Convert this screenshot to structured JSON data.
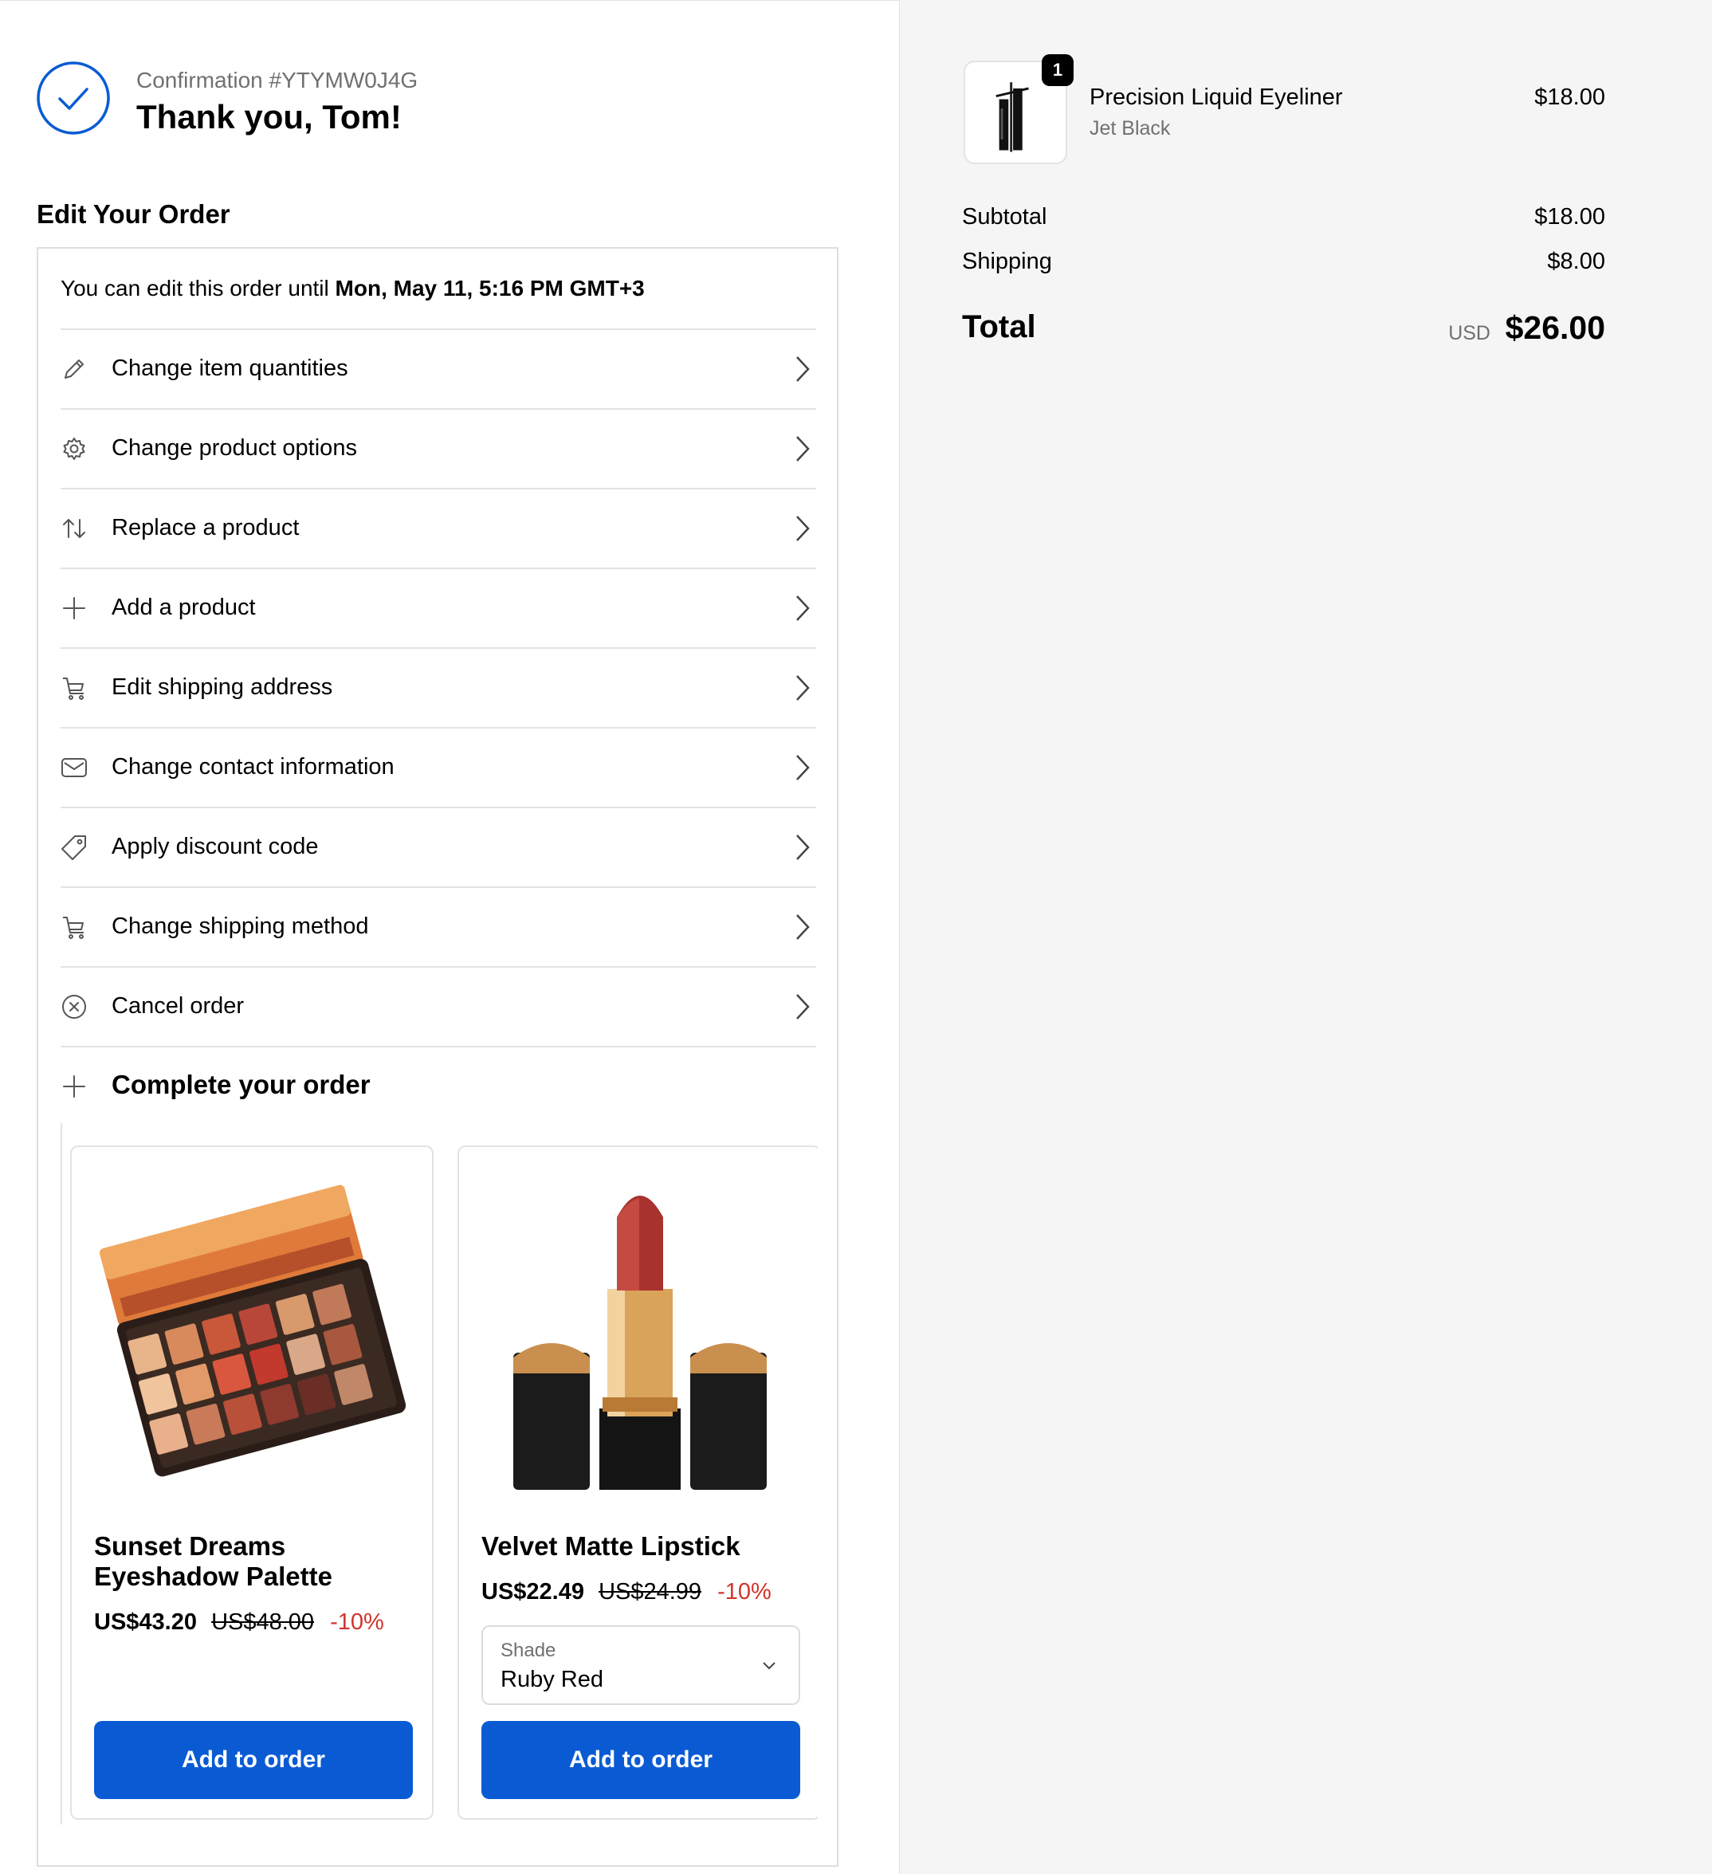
{
  "header": {
    "confirmation": "Confirmation #YTYMW0J4G",
    "thanks": "Thank you, Tom!"
  },
  "edit": {
    "title": "Edit Your Order",
    "note_prefix": "You can edit this order until ",
    "note_deadline": "Mon, May 11, 5:16 PM GMT+3",
    "options": [
      {
        "label": "Change item quantities",
        "icon": "pencil-icon"
      },
      {
        "label": "Change product options",
        "icon": "gear-icon"
      },
      {
        "label": "Replace a product",
        "icon": "swap-arrows-icon"
      },
      {
        "label": "Add a product",
        "icon": "plus-icon"
      },
      {
        "label": "Edit shipping address",
        "icon": "cart-icon"
      },
      {
        "label": "Change contact information",
        "icon": "envelope-icon"
      },
      {
        "label": "Apply discount code",
        "icon": "tag-icon"
      },
      {
        "label": "Change shipping method",
        "icon": "cart-icon"
      },
      {
        "label": "Cancel order",
        "icon": "close-circle-icon"
      }
    ],
    "complete_label": "Complete your order"
  },
  "upsell": [
    {
      "name": "Sunset Dreams Eyeshadow Palette",
      "price": "US$43.20",
      "compare_price": "US$48.00",
      "discount": "-10%",
      "button": "Add to order"
    },
    {
      "name": "Velvet Matte Lipstick",
      "price": "US$22.49",
      "compare_price": "US$24.99",
      "discount": "-10%",
      "option_label": "Shade",
      "option_value": "Ruby Red",
      "button": "Add to order"
    }
  ],
  "summary": {
    "item": {
      "name": "Precision Liquid Eyeliner",
      "variant": "Jet Black",
      "price": "$18.00",
      "quantity": "1"
    },
    "subtotal_label": "Subtotal",
    "subtotal": "$18.00",
    "shipping_label": "Shipping",
    "shipping": "$8.00",
    "total_label": "Total",
    "currency": "USD",
    "total": "$26.00"
  },
  "colors": {
    "accent": "#0a5bd3",
    "discount": "#d0342c",
    "sidebar_bg": "#f5f5f5"
  }
}
